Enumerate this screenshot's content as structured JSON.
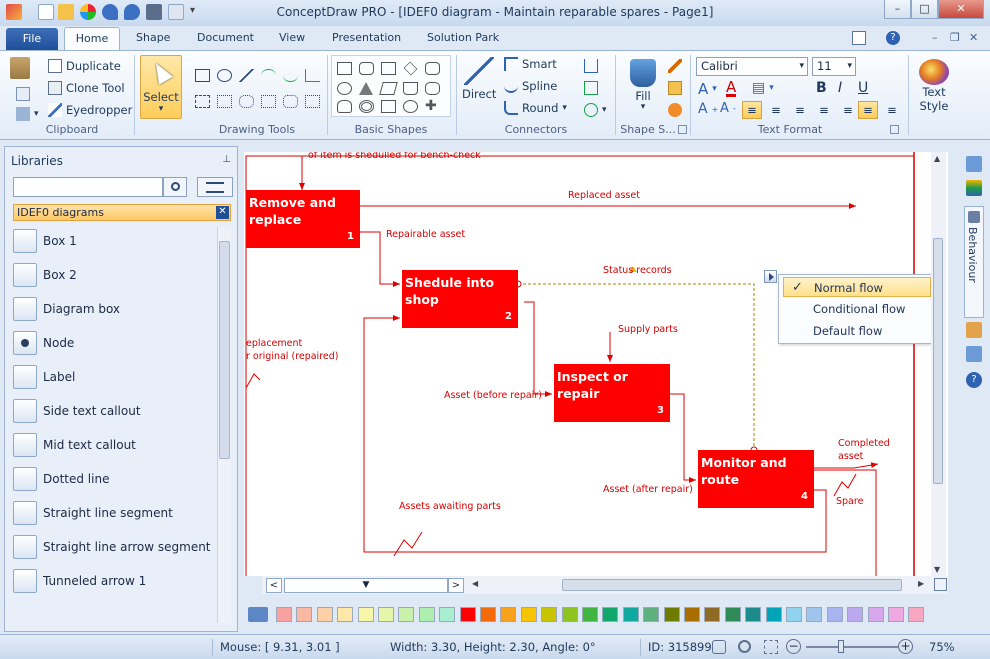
{
  "window": {
    "title": "ConceptDraw PRO - [IDEF0 diagram - Maintain reparable spares - Page1]",
    "controls": [
      "–",
      "□",
      "✕"
    ]
  },
  "ribbon": {
    "file_tab": "File",
    "tabs": [
      "Home",
      "Shape",
      "Document",
      "View",
      "Presentation",
      "Solution Park"
    ],
    "clipboard": {
      "label": "Clipboard",
      "duplicate": "Duplicate",
      "clone": "Clone Tool",
      "eyedropper": "Eyedropper"
    },
    "select_label": "Select",
    "drawing_tools_label": "Drawing Tools",
    "basic_shapes_label": "Basic Shapes",
    "connectors": {
      "label": "Connectors",
      "direct": "Direct",
      "smart": "Smart",
      "spline": "Spline",
      "round": "Round"
    },
    "fill_label": "Fill",
    "shape_style_label": "Shape S...",
    "text_format": {
      "label": "Text Format",
      "font": "Calibri",
      "size": "11"
    },
    "text_style": {
      "line1": "Text",
      "line2": "Style"
    }
  },
  "libraries": {
    "header": "Libraries",
    "search_placeholder": "",
    "active_library": "IDEF0 diagrams",
    "items": [
      "Box 1",
      "Box 2",
      "Diagram box",
      "Node",
      "Label",
      "Side text callout",
      "Mid text callout",
      "Dotted line",
      "Straight line segment",
      "Straight line arrow segment",
      "Tunneled arrow 1"
    ]
  },
  "diagram": {
    "top_cut_label": "of item is shedulled for bench-check",
    "blocks": [
      {
        "line1": "Remove and",
        "line2": "replace",
        "num": "1"
      },
      {
        "line1": "Shedule into shop",
        "line2": "",
        "num": "2"
      },
      {
        "line1": "Inspect or repair",
        "line2": "",
        "num": "3"
      },
      {
        "line1": "Monitor and",
        "line2": "route",
        "num": "4"
      }
    ],
    "labels": {
      "replaced_asset": "Replaced asset",
      "repairable_asset": "Repairable asset",
      "status_records": "Status records",
      "supply_parts": "Supply parts",
      "asset_before": "Asset (before repair)",
      "asset_after": "Asset (after repair)",
      "completed_asset": "Completed asset",
      "completed_line1": "Completed",
      "completed_line2": "asset",
      "spare": "Spare",
      "awaiting_parts": "Assets awaiting parts",
      "replacement_line1": "eplacement",
      "replacement_line2": "r original (repaired)"
    }
  },
  "flow_menu": {
    "items": [
      "Normal flow",
      "Conditional flow",
      "Default flow"
    ],
    "checked": "Normal flow"
  },
  "right_panel": {
    "behaviour_tab": "Behaviour"
  },
  "palette": {
    "colors": [
      "#f7a1a1",
      "#f9b9a3",
      "#fbd0a6",
      "#fde7a9",
      "#f8f6a9",
      "#e6f6a9",
      "#c9f1ab",
      "#aeeeb1",
      "#a8efd1",
      "#ff0000",
      "#f46a0b",
      "#f9a11b",
      "#f7c400",
      "#c9c400",
      "#8fc31f",
      "#3fb43f",
      "#10a86b",
      "#10a9a0",
      "#5fb07f",
      "#6e7d00",
      "#a86e00",
      "#8f6a24",
      "#2e8b57",
      "#1c8c8a",
      "#00a3b8",
      "#8fd3ef",
      "#9fc4ee",
      "#a8b4ef",
      "#bba8ee",
      "#d8a8ee",
      "#f0a8e0",
      "#f7a8c0"
    ]
  },
  "status": {
    "mouse": "Mouse: [ 9.31, 3.01 ]",
    "size": "Width: 3.30,  Height: 2.30,  Angle: 0°",
    "id": "ID: 315899",
    "zoom": "75%"
  }
}
